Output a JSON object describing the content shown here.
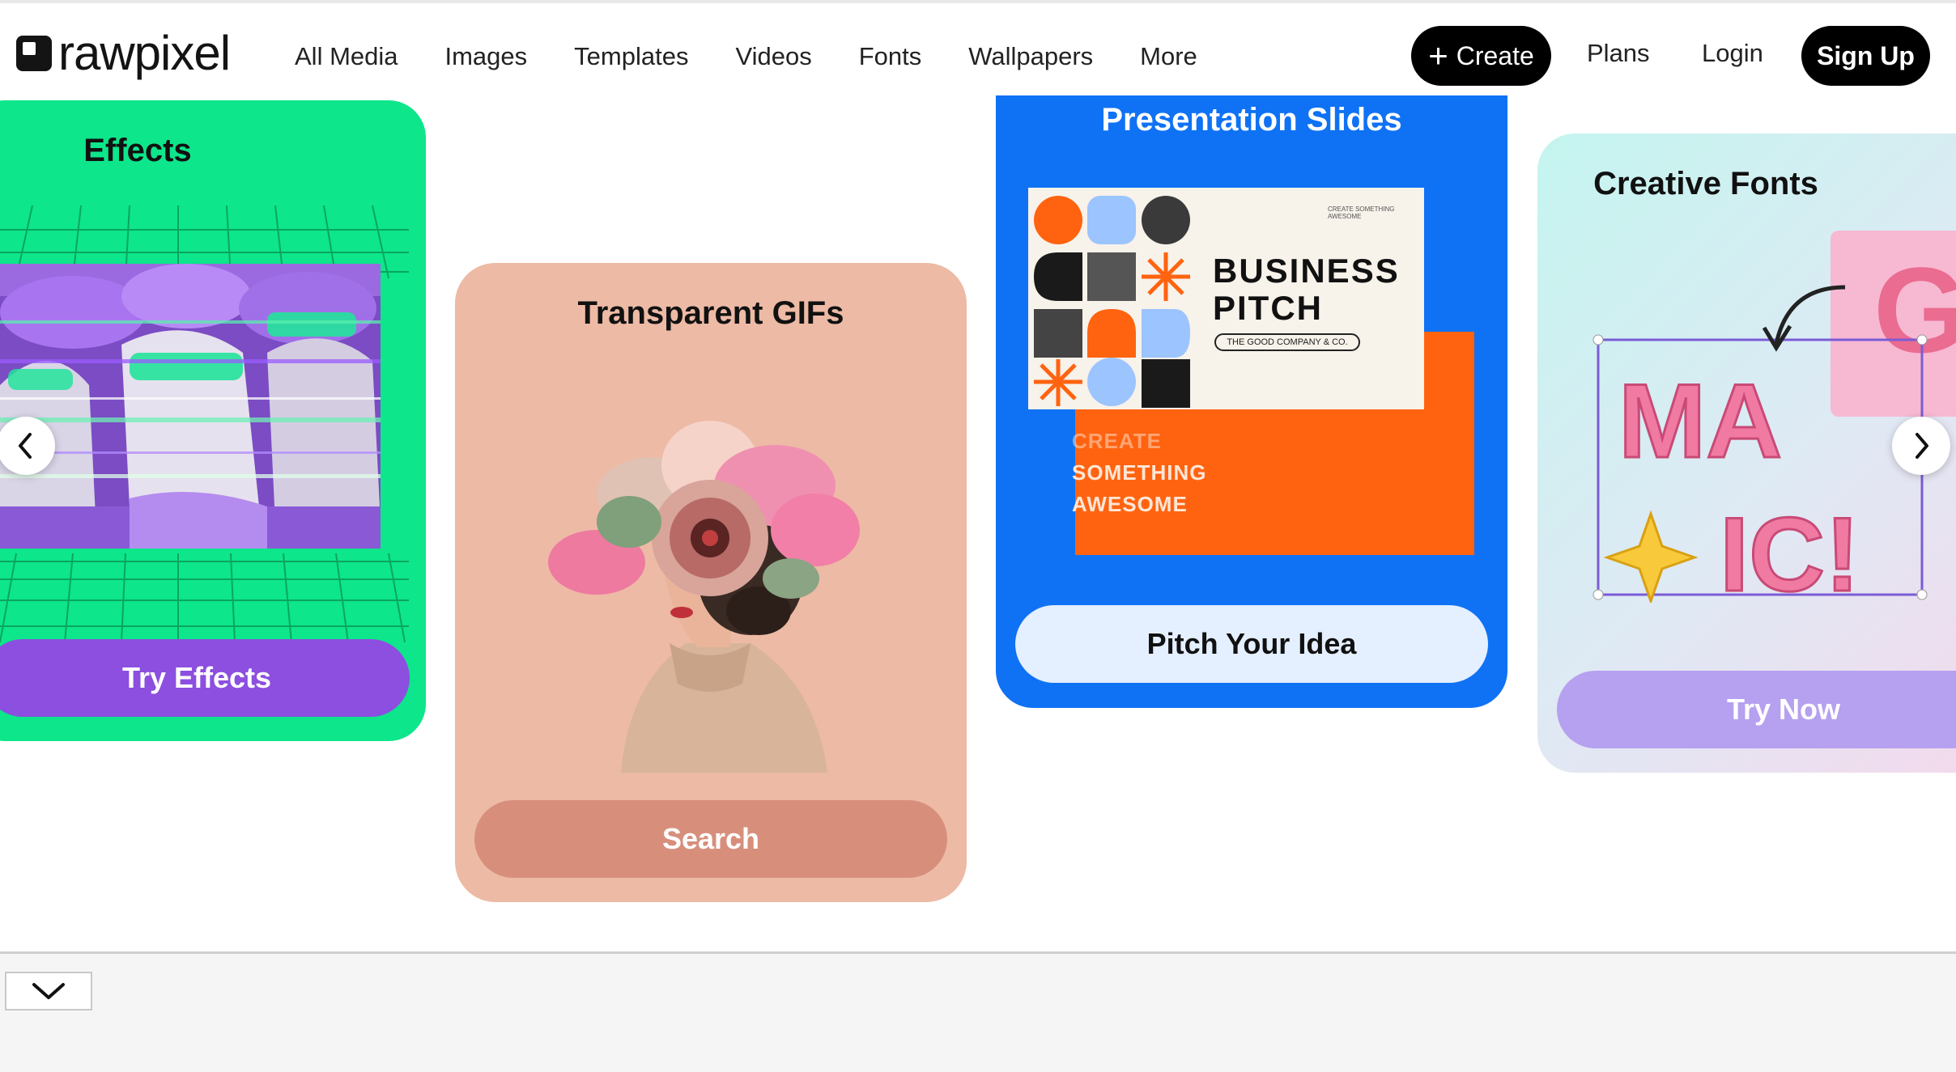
{
  "nav": {
    "logo_text": "rawpixel",
    "links": [
      "All Media",
      "Images",
      "Templates",
      "Videos",
      "Fonts",
      "Wallpapers",
      "More"
    ],
    "create_label": "Create",
    "plans_label": "Plans",
    "login_label": "Login",
    "signup_label": "Sign Up"
  },
  "cards": {
    "effects": {
      "title": "Effects",
      "button": "Try Effects",
      "color": "#0de68a",
      "button_color": "#8c4fe0"
    },
    "gifs": {
      "title": "Transparent GIFs",
      "button": "Search",
      "color": "#edbaa5",
      "button_color": "#d78f7c"
    },
    "slides": {
      "title": "Presentation Slides",
      "button": "Pitch Your Idea",
      "color": "#0f72f5",
      "slide_heading_1": "BUSINESS",
      "slide_heading_2": "PITCH",
      "slide_pill": "THE GOOD COMPANY & CO.",
      "slide_tiny": "CREATE SOMETHING AWESOME",
      "orange_line_1": "CREATE",
      "orange_line_2": "SOMETHING",
      "orange_line_3": "AWESOME"
    },
    "fonts": {
      "title": "Creative Fonts",
      "button": "Try Now",
      "art_line_1": "MA",
      "art_line_2": "IC!",
      "art_letter": "G"
    }
  },
  "carousel": {
    "prev_icon": "chevron-left-icon",
    "next_icon": "chevron-right-icon"
  },
  "bottom": {
    "collapse_icon": "chevron-down-icon"
  }
}
